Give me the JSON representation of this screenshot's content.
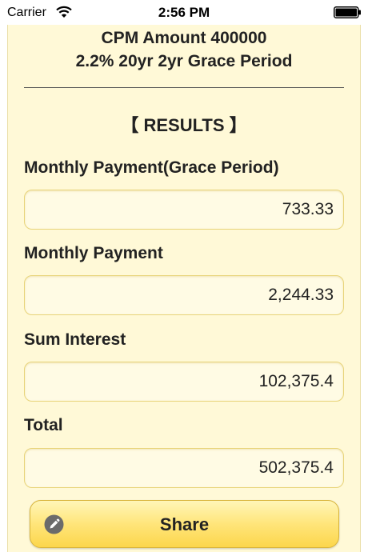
{
  "status_bar": {
    "carrier": "Carrier",
    "time": "2:56 PM"
  },
  "summary": {
    "line1": "CPM Amount 400000",
    "line2": "2.2% 20yr 2yr Grace Period"
  },
  "results": {
    "heading": "【 RESULTS 】",
    "fields": [
      {
        "label": "Monthly Payment(Grace Period)",
        "value": "733.33"
      },
      {
        "label": "Monthly Payment",
        "value": "2,244.33"
      },
      {
        "label": "Sum Interest",
        "value": "102,375.4"
      },
      {
        "label": "Total",
        "value": "502,375.4"
      }
    ]
  },
  "share": {
    "label": "Share",
    "icon": "pencil-icon"
  },
  "colors": {
    "background": "#fff9d7",
    "field_border": "#e8d47a",
    "button_top": "#fff6b8",
    "button_bottom": "#fcd64c"
  }
}
